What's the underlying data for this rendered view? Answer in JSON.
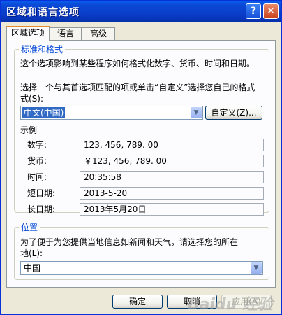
{
  "window": {
    "title": "区域和语言选项",
    "help_glyph": "?",
    "close_glyph": "✕"
  },
  "tabs": [
    {
      "label": "区域选项",
      "active": true
    },
    {
      "label": "语言",
      "active": false
    },
    {
      "label": "高级",
      "active": false
    }
  ],
  "standards": {
    "legend": "标准和格式",
    "description": "这个选项影响到某些程序如何格式化数字、货币、时间和日期。",
    "select_prompt_line1": "选择一个与其首选项匹配的项或单击“自定义”选择您自己的格式",
    "select_prompt_line2": "式(S):",
    "format_value": "中文(中国)",
    "customize_label": "自定义(Z)..."
  },
  "samples": {
    "heading": "示例",
    "rows": [
      {
        "label": "数字:",
        "value": "123, 456, 789. 00"
      },
      {
        "label": "货币:",
        "value": "￥123, 456, 789. 00"
      },
      {
        "label": "时间:",
        "value": "20:35:58"
      },
      {
        "label": "短日期:",
        "value": "2013-5-20"
      },
      {
        "label": "长日期:",
        "value": "2013年5月20日"
      }
    ]
  },
  "location": {
    "legend": "位置",
    "description_line1": "为了便于为您提供当地信息如新闻和天气，请选择您的所在",
    "description_line2": "地(L):",
    "value": "中国"
  },
  "footer": {
    "ok_label": "确定",
    "cancel_label": "取消",
    "apply_label": "应用(A)"
  },
  "watermark": "Baidu 经验",
  "colors": {
    "titlebar": "#0a49d6",
    "group_legend": "#0046d5",
    "selection": "#316ac5",
    "active_tab_accent": "#e68b2c"
  }
}
